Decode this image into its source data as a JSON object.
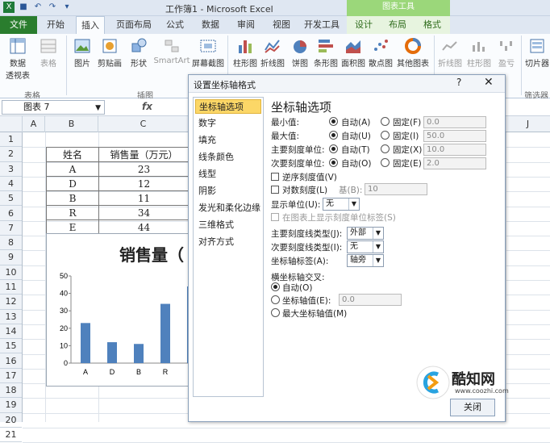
{
  "window": {
    "title": "工作簿1 - Microsoft Excel",
    "context_group": "图表工具"
  },
  "tabs": [
    "文件",
    "开始",
    "插入",
    "页面布局",
    "公式",
    "数据",
    "审阅",
    "视图",
    "开发工具",
    "设计",
    "布局",
    "格式"
  ],
  "ribbon": {
    "buttons": [
      "数据\n透视表",
      "表格",
      "图片",
      "剪贴画",
      "形状",
      "SmartArt",
      "屏幕截图",
      "柱形图",
      "折线图",
      "饼图",
      "条形图",
      "面积图",
      "散点图",
      "其他图表",
      "折线图",
      "柱形图",
      "盈亏",
      "切片器"
    ],
    "groups": [
      "表格",
      "插图",
      "筛选器"
    ]
  },
  "formula_bar": {
    "name_box": "图表 7",
    "fx": "fx"
  },
  "columns": [
    "A",
    "B",
    "C",
    "J"
  ],
  "rows": [
    "1",
    "2",
    "3",
    "4",
    "5",
    "6",
    "7",
    "8",
    "9",
    "10",
    "11",
    "12",
    "13",
    "14",
    "15",
    "16",
    "17",
    "18",
    "19",
    "20",
    "21"
  ],
  "table": {
    "headers": [
      "姓名",
      "销售量（万元）"
    ],
    "rows": [
      [
        "A",
        "23"
      ],
      [
        "D",
        "12"
      ],
      [
        "B",
        "11"
      ],
      [
        "R",
        "34"
      ],
      [
        "E",
        "44"
      ]
    ]
  },
  "chart_data": {
    "type": "bar",
    "title": "销售量（",
    "categories": [
      "A",
      "D",
      "B",
      "R",
      "E"
    ],
    "values": [
      23,
      12,
      11,
      34,
      44
    ],
    "yticks": [
      "0",
      "10",
      "20",
      "30",
      "40",
      "50"
    ],
    "ylim": [
      0,
      50
    ],
    "bar_color": "#4f81bd"
  },
  "dialog": {
    "title": "设置坐标轴格式",
    "help": "?",
    "close": "✕",
    "categories": [
      "坐标轴选项",
      "数字",
      "填充",
      "线条颜色",
      "线型",
      "阴影",
      "发光和柔化边缘",
      "三维格式",
      "对齐方式"
    ],
    "section_title": "坐标轴选项",
    "axis_rows": [
      {
        "label": "最小值:",
        "auto": "自动(A)",
        "fixed": "固定(F)",
        "value": "0.0",
        "auto_on": true
      },
      {
        "label": "最大值:",
        "auto": "自动(U)",
        "fixed": "固定(I)",
        "value": "50.0",
        "auto_on": true
      },
      {
        "label": "主要刻度单位:",
        "auto": "自动(T)",
        "fixed": "固定(X)",
        "value": "10.0",
        "auto_on": true
      },
      {
        "label": "次要刻度单位:",
        "auto": "自动(O)",
        "fixed": "固定(E)",
        "value": "2.0",
        "auto_on": true
      }
    ],
    "reverse_order": "逆序刻度值(V)",
    "log_scale": "对数刻度(L)",
    "log_base_label": "基(B):",
    "log_base_value": "10",
    "display_units_label": "显示单位(U):",
    "display_units_value": "无",
    "show_units_label": "在图表上显示刻度单位标签(S)",
    "major_tick_label": "主要刻度线类型(J):",
    "major_tick_value": "外部",
    "minor_tick_label": "次要刻度线类型(I):",
    "minor_tick_value": "无",
    "axis_labels_label": "坐标轴标签(A):",
    "axis_labels_value": "轴旁",
    "cross_title": "横坐标轴交叉:",
    "cross_options": [
      "自动(O)",
      "坐标轴值(E):",
      "最大坐标轴值(M)"
    ],
    "cross_value": "0.0",
    "close_button": "关闭"
  },
  "watermark": {
    "text": "酷知网",
    "url": "www.coozhi.com"
  }
}
